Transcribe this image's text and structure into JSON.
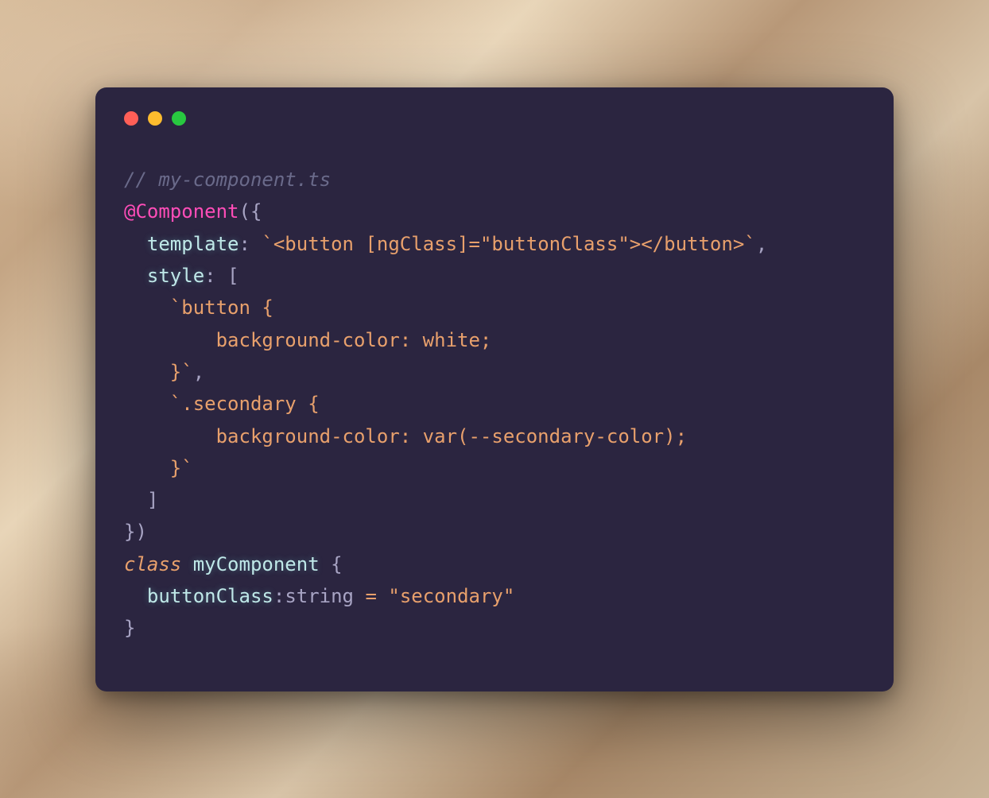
{
  "window": {
    "traffic_lights": [
      "close",
      "minimize",
      "zoom"
    ]
  },
  "code": {
    "comment": "// my-component.ts",
    "decorator_at": "@",
    "decorator_name": "Component",
    "paren_open": "({",
    "template_key": "template",
    "colon_space": ": ",
    "template_value": "`<button [ngClass]=\"buttonClass\"></button>`",
    "comma": ",",
    "style_key": "style",
    "bracket_open": "[",
    "style_rule_1a": "`button {",
    "style_rule_1b": "        background-color: white;",
    "style_rule_1c": "    }`",
    "style_rule_2a": "`.secondary {",
    "style_rule_2b": "        background-color: var(--secondary-color);",
    "style_rule_2c": "    }`",
    "bracket_close": "]",
    "paren_close": "})",
    "class_kw": "class",
    "class_name": "myComponent",
    "brace_open": " {",
    "prop_name": "buttonClass",
    "prop_colon": ":",
    "prop_type": "string",
    "equals": " = ",
    "prop_value": "\"secondary\"",
    "brace_close": "}"
  }
}
